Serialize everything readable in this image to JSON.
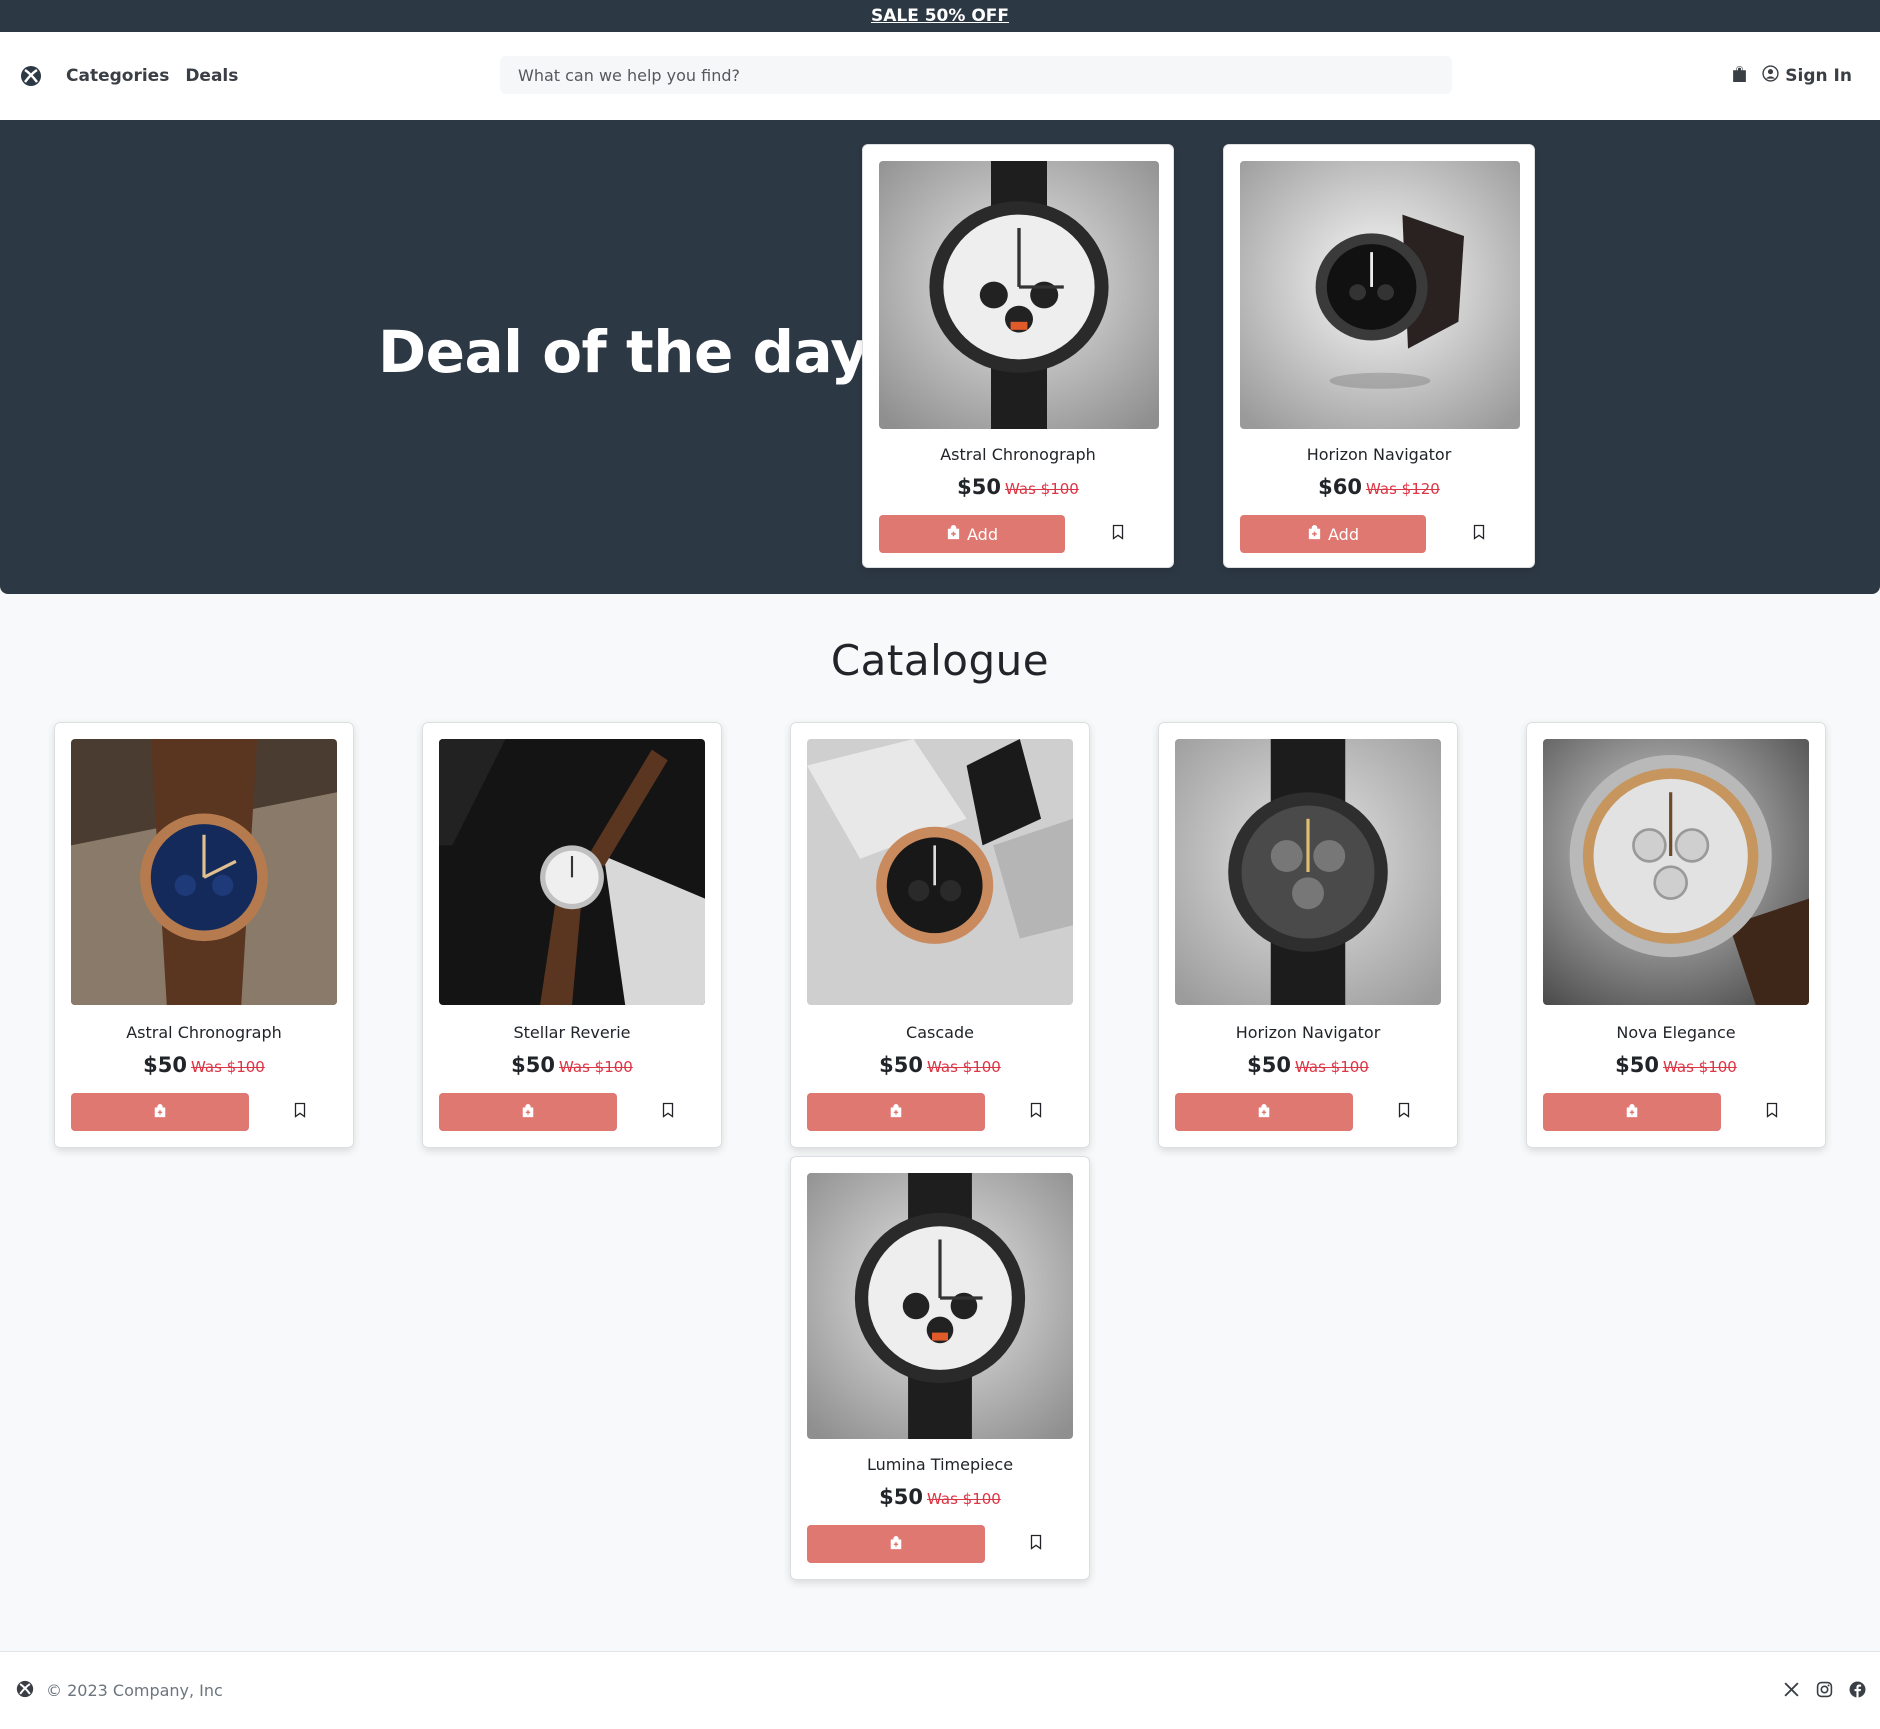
{
  "announcement": {
    "text": "SALE 50% OFF"
  },
  "nav": {
    "links": [
      "Categories",
      "Deals"
    ],
    "search_placeholder": "What can we help you find?",
    "signin_label": "Sign In"
  },
  "hero": {
    "title": "Deal of the day",
    "products": [
      {
        "name": "Astral Chronograph",
        "price": "$50",
        "was": "Was $100",
        "add_label": "Add",
        "image": "white-dial-chronograph"
      },
      {
        "name": "Horizon Navigator",
        "price": "$60",
        "was": "Was $120",
        "add_label": "Add",
        "image": "black-dial-chronograph"
      }
    ]
  },
  "catalogue": {
    "title": "Catalogue",
    "products": [
      {
        "name": "Astral Chronograph",
        "price": "$50",
        "was": "Was $100",
        "image": "blue-dial-on-wrist"
      },
      {
        "name": "Stellar Reverie",
        "price": "$50",
        "was": "Was $100",
        "image": "white-dial-brown-strap"
      },
      {
        "name": "Cascade",
        "price": "$50",
        "was": "Was $100",
        "image": "black-rose-gold-chronograph"
      },
      {
        "name": "Horizon Navigator",
        "price": "$50",
        "was": "Was $100",
        "image": "dark-skeleton-chronograph"
      },
      {
        "name": "Nova Elegance",
        "price": "$50",
        "was": "Was $100",
        "image": "silver-gold-chronograph"
      },
      {
        "name": "Lumina Timepiece",
        "price": "$50",
        "was": "Was $100",
        "image": "white-dial-chronograph"
      }
    ]
  },
  "footer": {
    "copyright": "© 2023 Company, Inc"
  },
  "icons": {
    "logo": "xbox-logo-icon",
    "cart": "shopping-bag-icon",
    "account": "person-circle-icon",
    "add": "bag-plus-icon",
    "save": "bookmark-icon",
    "social": [
      "x-twitter-icon",
      "instagram-icon",
      "facebook-icon"
    ]
  },
  "colors": {
    "header_dark": "#2d3845",
    "add_button": "#e07872",
    "was_price": "#dc3545",
    "page_bg": "#f8f9fa"
  }
}
